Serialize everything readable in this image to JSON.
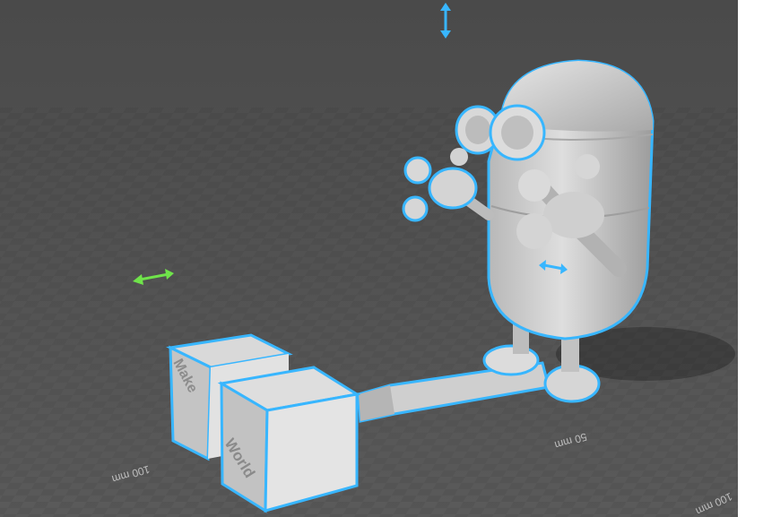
{
  "viewport": {
    "ruler_labels": {
      "front_100": "100 mm",
      "right_50": "50 mm",
      "corner_100": "100 mm"
    },
    "embossed_text": {
      "block_left": "Make",
      "block_right": "World"
    },
    "handles": {
      "vertical_move_icon": "double-arrow-vertical",
      "horizontal_move_icon": "double-arrow-horizontal",
      "rotate_icon": "double-arrow-horizontal"
    },
    "colors": {
      "selection_outline": "#38b6ff",
      "move_handle_green": "#6fe34a",
      "move_handle_blue": "#38b6ff",
      "model_gray": "#c9c9c9"
    }
  }
}
